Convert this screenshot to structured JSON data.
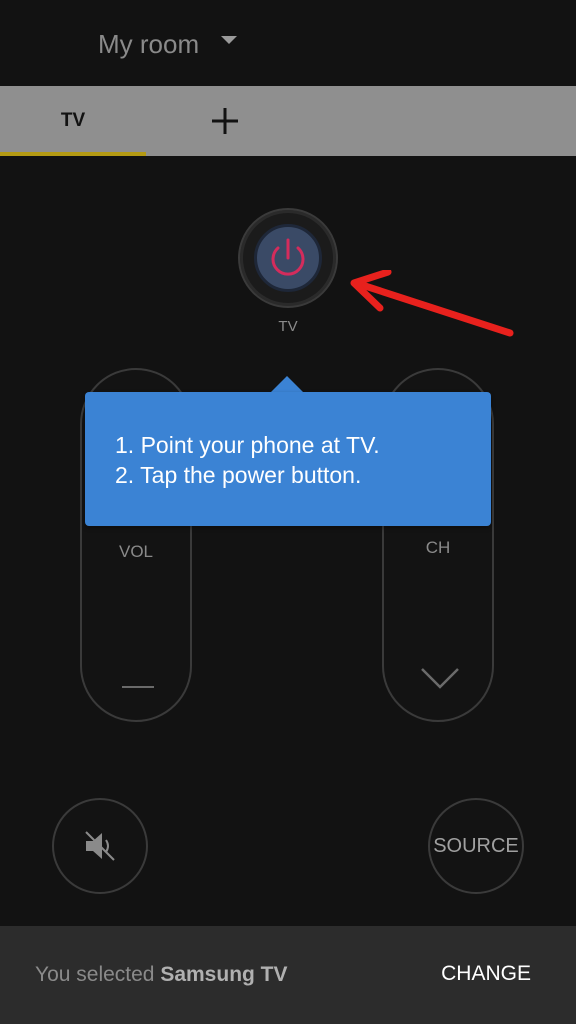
{
  "header": {
    "room_name": "My room",
    "caret_icon": "dropdown-caret-icon"
  },
  "tabs": {
    "items": [
      {
        "label": "TV",
        "active": true
      }
    ],
    "add_icon": "plus-icon",
    "accent_color": "#b49a14"
  },
  "remote": {
    "power_label": "TV",
    "power_icon": "power-icon",
    "power_icon_color": "#d42c5c",
    "vol_label": "VOL",
    "ch_label": "CH",
    "vol_down_icon": "minus-icon",
    "ch_down_icon": "chevron-down-icon",
    "mute_icon": "mute-icon",
    "source_label": "SOURCE"
  },
  "tooltip": {
    "line1": "1. Point your phone at TV.",
    "line2": "2. Tap the power button.",
    "color": "#3b83d4"
  },
  "annotation": {
    "icon": "red-arrow-icon",
    "color": "#e8211d"
  },
  "bottom_bar": {
    "selected_prefix": "You selected ",
    "selected_device": "Samsung TV",
    "change_label": "CHANGE"
  }
}
